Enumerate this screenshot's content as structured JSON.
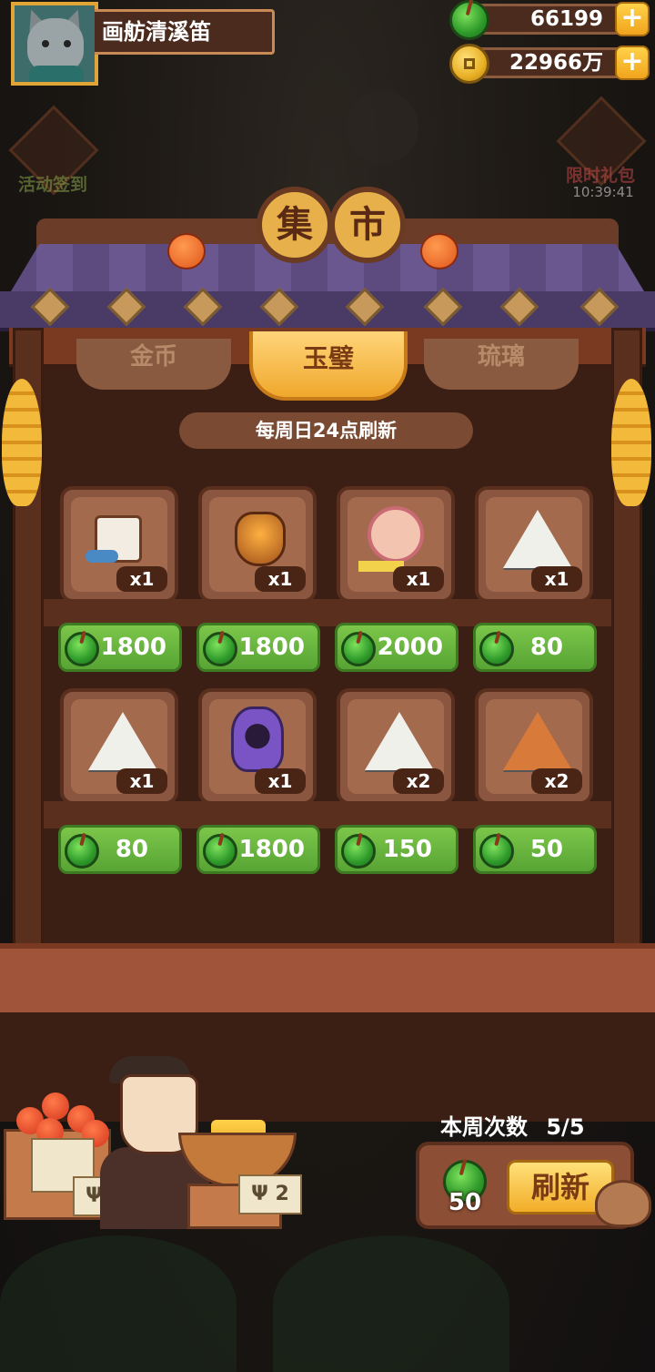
{
  "player": {
    "name": "画舫清溪笛"
  },
  "currencies": [
    {
      "icon": "jade-icon",
      "value": "66199",
      "add_label": "+"
    },
    {
      "icon": "coin-icon",
      "value": "22966万",
      "add_label": "+"
    }
  ],
  "side_buttons": {
    "left_label": "活动签到",
    "right_label": "限时礼包",
    "right_timer": "10:39:41"
  },
  "shop": {
    "title_chars": [
      "集",
      "市"
    ],
    "tabs": [
      {
        "label": "金币",
        "active": false
      },
      {
        "label": "玉璧",
        "active": true
      },
      {
        "label": "琉璃",
        "active": false
      }
    ],
    "refresh_note": "每周日24点刷新",
    "items": [
      {
        "icon": "dice-toy-icon",
        "qty": "x1",
        "price": "1800"
      },
      {
        "icon": "fire-pot-icon",
        "qty": "x1",
        "price": "1800"
      },
      {
        "icon": "girl-portrait-icon",
        "qty": "x1",
        "price": "2000"
      },
      {
        "icon": "white-rune-stone-icon",
        "qty": "x1",
        "price": "80"
      },
      {
        "icon": "spiral-rune-stone-icon",
        "qty": "x1",
        "price": "80"
      },
      {
        "icon": "purple-mirror-icon",
        "qty": "x1",
        "price": "1800"
      },
      {
        "icon": "wave-rune-stone-icon",
        "qty": "x2",
        "price": "150"
      },
      {
        "icon": "orange-rune-stone-icon",
        "qty": "x2",
        "price": "50"
      }
    ]
  },
  "refresh": {
    "weekly_label": "本周次数",
    "weekly_count": "5/5",
    "cost": "50",
    "button_label": "刷新"
  },
  "vendor": {
    "tag_1": "",
    "tag_2": "Ψ 2",
    "tag_3": "Ψ 2"
  },
  "colors": {
    "jade_green": "#58a434",
    "gold": "#f0a82c",
    "wood": "#5a2f1e"
  }
}
